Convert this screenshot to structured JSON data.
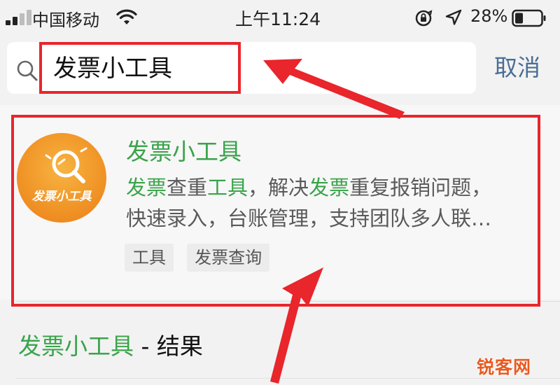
{
  "status_bar": {
    "carrier": "中国移动",
    "time": "上午11:24",
    "battery_percent": "28%",
    "icons": [
      "signal-icon",
      "wifi-icon",
      "orientation-lock-icon",
      "location-icon",
      "battery-icon"
    ]
  },
  "search": {
    "query": "发票小工具",
    "cancel_label": "取消"
  },
  "result": {
    "name": "发票小工具",
    "logo_text": "发票小工具",
    "description_line1": [
      {
        "text": "发票",
        "highlight": true
      },
      {
        "text": "查重",
        "highlight": false
      },
      {
        "text": "工具",
        "highlight": true
      },
      {
        "text": "，解决",
        "highlight": false
      },
      {
        "text": "发票",
        "highlight": true
      },
      {
        "text": "重复报销问题，",
        "highlight": false
      }
    ],
    "description_line2": "快速录入，台账管理，支持团队多人联…",
    "tags": [
      "工具",
      "发票查询"
    ]
  },
  "more_results": {
    "keyword": "发票小工具",
    "suffix": " - 结果"
  },
  "watermark": "锐客网",
  "colors": {
    "highlight_green": "#3aa34a",
    "cancel_blue": "#4a6d95",
    "annotation_red": "#e8262b",
    "logo_orange": "#f39a2c"
  }
}
